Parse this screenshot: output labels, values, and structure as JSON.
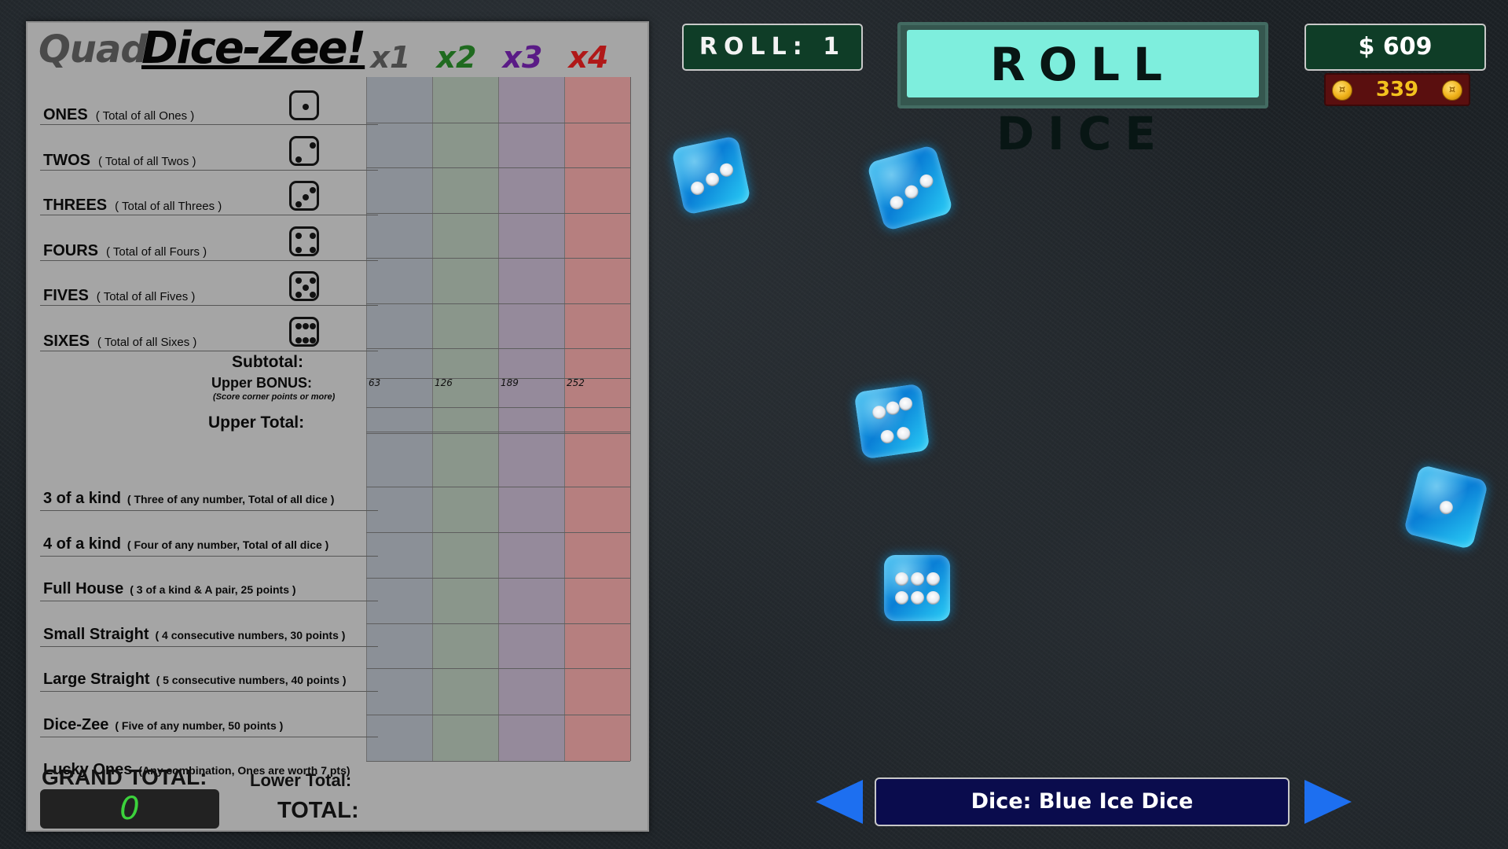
{
  "scorecard": {
    "logo_prefix": "Quad",
    "logo_title": "Dice-Zee!",
    "multipliers": [
      {
        "label": "x1",
        "color": "#4a4a4a"
      },
      {
        "label": "x2",
        "color": "#1f6a1f"
      },
      {
        "label": "x3",
        "color": "#5a1b86"
      },
      {
        "label": "x4",
        "color": "#b01818"
      }
    ],
    "column_colors": [
      "#8b9097",
      "#8a968b",
      "#958a9b",
      "#b67f7f"
    ],
    "upper_rows": [
      {
        "name": "ONES",
        "desc": "( Total of all Ones )",
        "pips": 1
      },
      {
        "name": "TWOS",
        "desc": "( Total of all Twos )",
        "pips": 2
      },
      {
        "name": "THREES",
        "desc": "( Total of all Threes )",
        "pips": 3
      },
      {
        "name": "FOURS",
        "desc": "( Total of all Fours )",
        "pips": 4
      },
      {
        "name": "FIVES",
        "desc": "( Total of all Fives )",
        "pips": 5
      },
      {
        "name": "SIXES",
        "desc": "( Total of all Sixes )",
        "pips": 6
      }
    ],
    "subtotal_label": "Subtotal:",
    "upper_bonus_label": "Upper BONUS:",
    "upper_bonus_note": "(Score corner points or more)",
    "upper_bonus_thresholds": [
      "63",
      "126",
      "189",
      "252"
    ],
    "upper_total_label": "Upper Total:",
    "lower_rows": [
      {
        "name": "3 of a kind",
        "desc": "( Three of any number, Total of all dice )"
      },
      {
        "name": "4 of a kind",
        "desc": "( Four of any number, Total of all dice )"
      },
      {
        "name": "Full House",
        "desc": "( 3 of a kind & A pair,  25 points )"
      },
      {
        "name": "Small Straight",
        "desc": "( 4 consecutive numbers, 30 points )"
      },
      {
        "name": "Large Straight",
        "desc": "( 5 consecutive numbers, 40 points )"
      },
      {
        "name": "Dice-Zee",
        "desc": "( Five of any number, 50 points )"
      },
      {
        "name": "Lucky Ones",
        "desc": "(Any combination, Ones are worth 7 pts)"
      }
    ],
    "grand_total_label": "GRAND TOTAL:",
    "grand_total_value": "0",
    "lower_total_label": "Lower Total:",
    "total_label": "TOTAL:"
  },
  "hud": {
    "roll_counter": "ROLL: 1",
    "roll_button": "ROLL DICE",
    "money": "$ 609",
    "coins": "339"
  },
  "dice_on_table": [
    {
      "name": "die-1",
      "value": 3
    },
    {
      "name": "die-2",
      "value": 3
    },
    {
      "name": "die-3",
      "value": 5
    },
    {
      "name": "die-4",
      "value": 6
    },
    {
      "name": "die-5",
      "value": 1
    }
  ],
  "dice_selector": {
    "label": "Dice:  Blue Ice Dice"
  }
}
